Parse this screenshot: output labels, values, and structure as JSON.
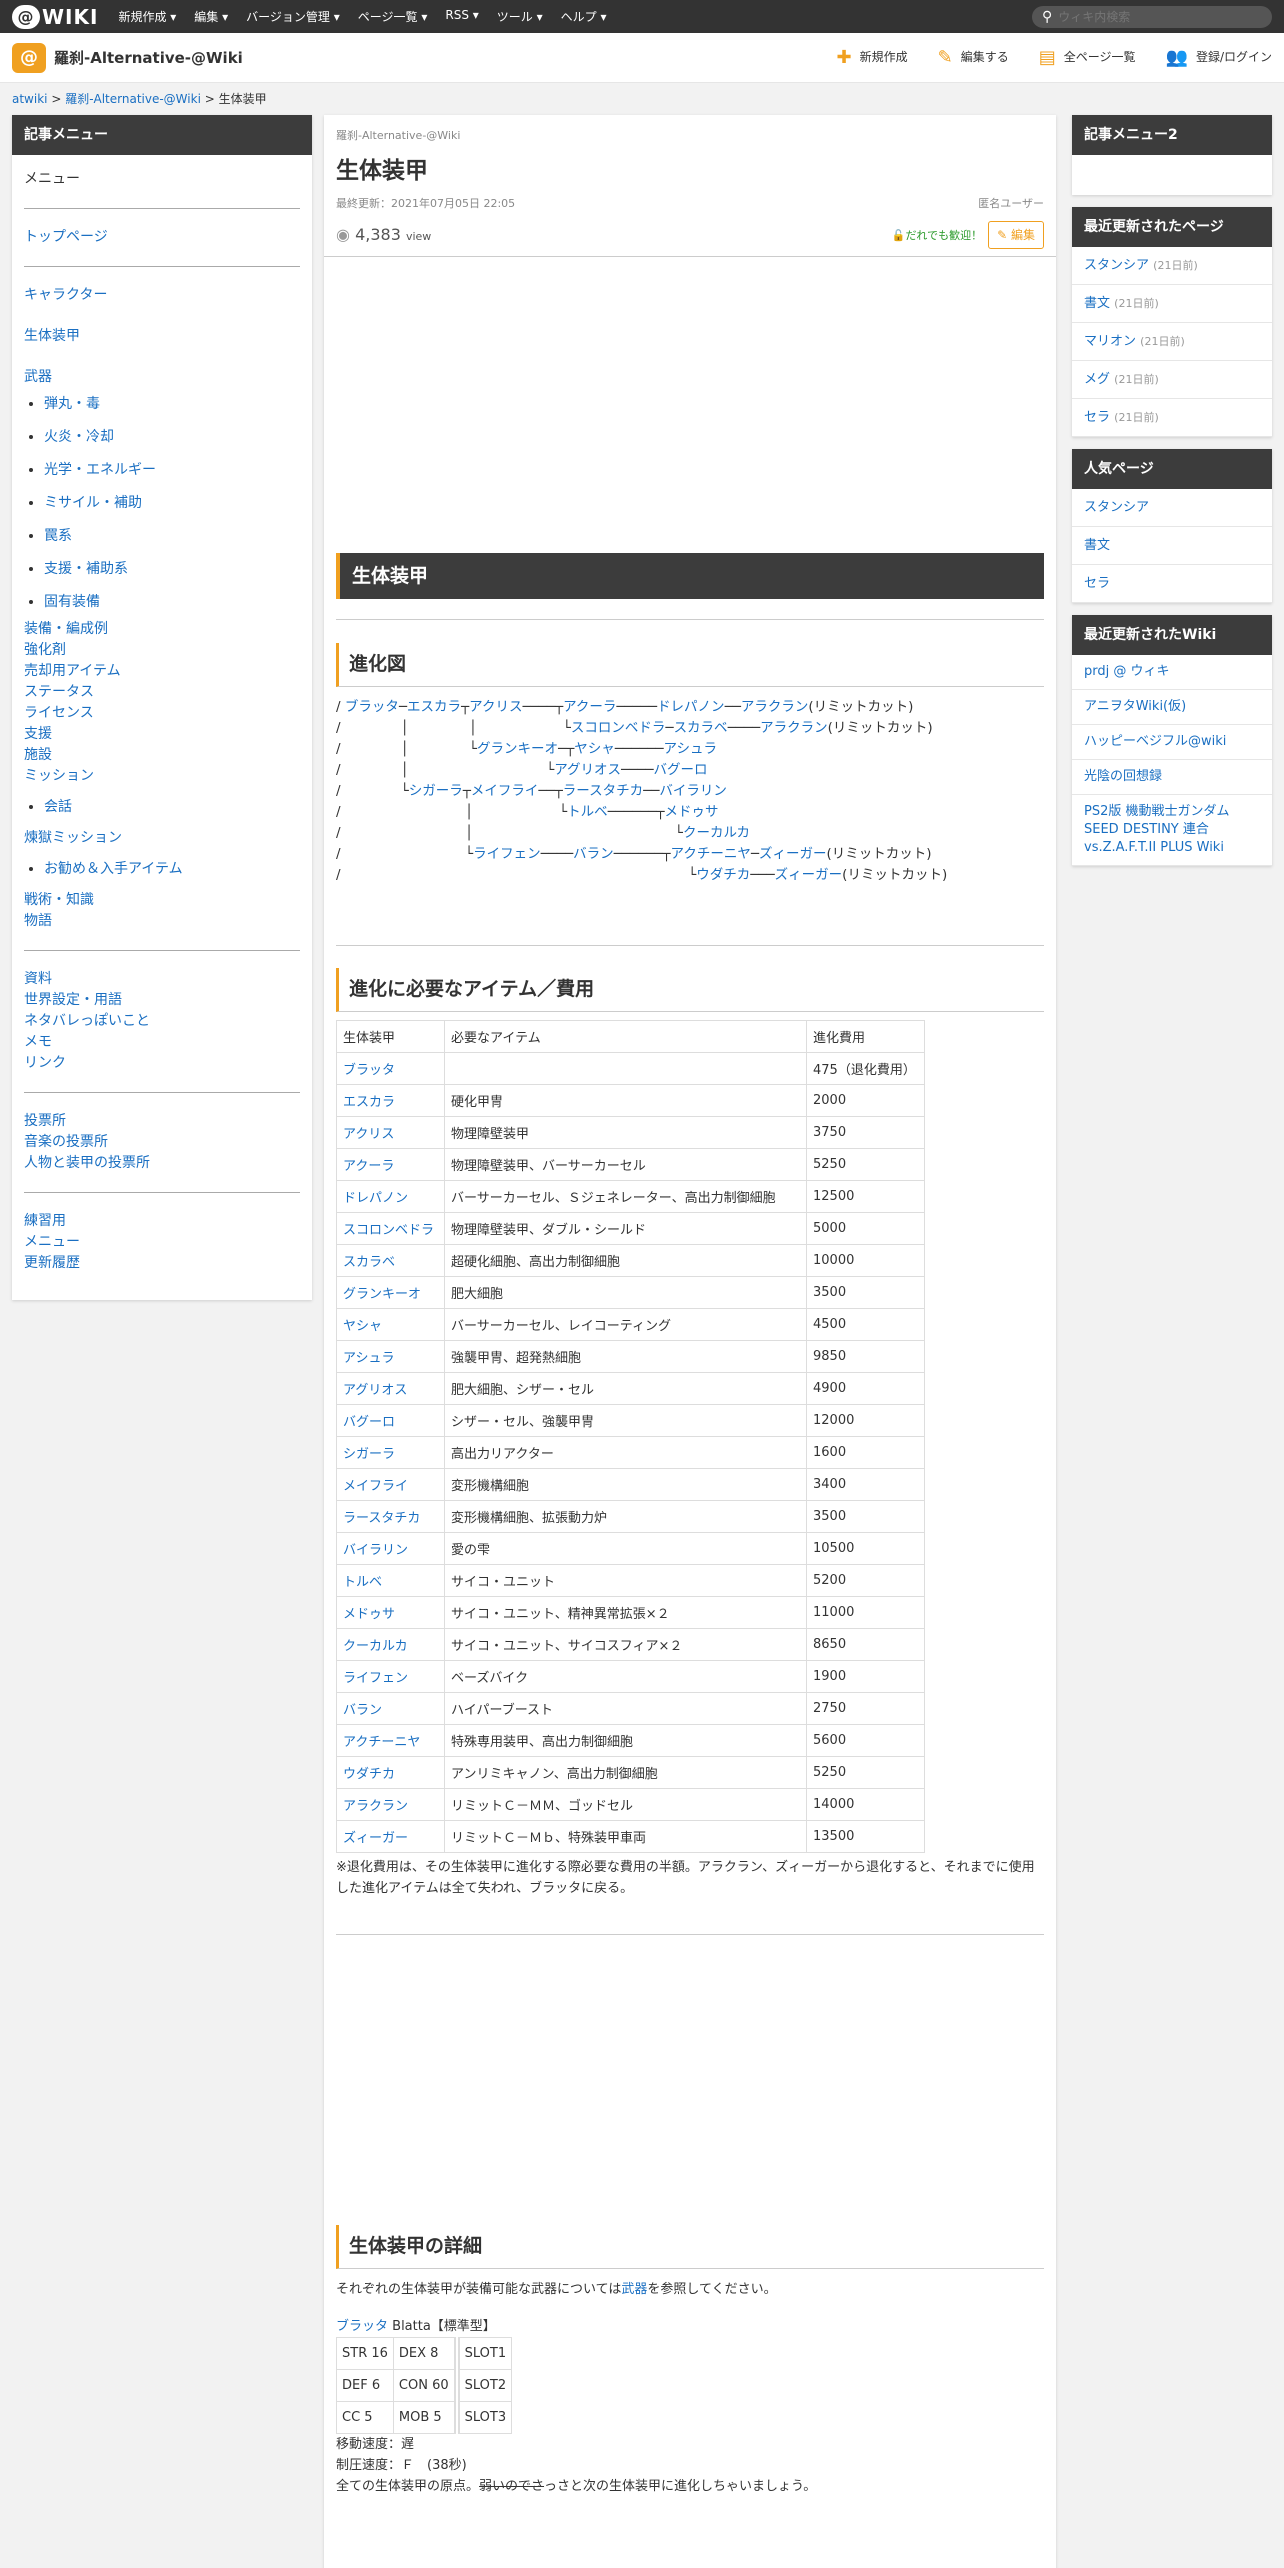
{
  "topbar": {
    "logo": "WIKI",
    "menu": [
      "新規作成 ▾",
      "編集 ▾",
      "バージョン管理 ▾",
      "ページ一覧 ▾",
      "RSS ▾",
      "ツール ▾",
      "ヘルプ ▾"
    ],
    "search_placeholder": "ウィキ内検索"
  },
  "site": {
    "title": "羅刹-Alternative-@Wiki",
    "actions": [
      {
        "icon": "plus-icon",
        "glyph": "✚",
        "label": "新規作成"
      },
      {
        "icon": "pencil-icon",
        "glyph": "✎",
        "label": "編集する"
      },
      {
        "icon": "page-icon",
        "glyph": "▤",
        "label": "全ページ一覧"
      },
      {
        "icon": "user-icon",
        "glyph": "👥",
        "label": "登録/ログイン"
      }
    ]
  },
  "breadcrumb": {
    "root": "atwiki",
    "site": "羅刹-Alternative-@Wiki",
    "page": "生体装甲",
    "sep": " > "
  },
  "left": {
    "title": "記事メニュー",
    "menu": "メニュー",
    "top": "トップページ",
    "chara": "キャラクター",
    "armor": "生体装甲",
    "weapon": "武器",
    "weapons": [
      "弾丸・毒",
      "火炎・冷却",
      "光学・エネルギー",
      "ミサイル・補助",
      "罠系",
      "支援・補助系",
      "固有装備"
    ],
    "misc": [
      "装備・編成例",
      "強化剤",
      "売却用アイテム",
      "ステータス",
      "ライセンス",
      "支援",
      "施設",
      "ミッション"
    ],
    "talk": "会話",
    "prison": "煉獄ミッション",
    "items": "お勧め＆入手アイテム",
    "battle": [
      "戦術・知識",
      "物語"
    ],
    "data": [
      "資料",
      "世界設定・用語",
      "ネタバレっぽいこと",
      "メモ",
      "リンク"
    ],
    "vote": [
      "投票所",
      "音楽の投票所",
      "人物と装甲の投票所"
    ],
    "practice": [
      "練習用",
      "メニュー",
      "更新履歴"
    ]
  },
  "main": {
    "wiki_name": "羅刹-Alternative-@Wiki",
    "title": "生体装甲",
    "updated": "最終更新：2021年07月05日 22:05",
    "user": "匿名ユーザー",
    "views": "4,383",
    "views_unit": "view",
    "welcome": "だれでも歓迎！",
    "edit": "編集",
    "h2": "生体装甲",
    "tree_h": "進化図",
    "cost_h": "進化に必要なアイテム／費用",
    "cost_head": [
      "生体装甲",
      "必要なアイテム",
      "進化費用"
    ],
    "cost_rows": [
      [
        "ブラッタ",
        "",
        "475（退化費用）"
      ],
      [
        "エスカラ",
        "硬化甲冑",
        "2000"
      ],
      [
        "アクリス",
        "物理障壁装甲",
        "3750"
      ],
      [
        "アクーラ",
        "物理障壁装甲、バーサーカーセル",
        "5250"
      ],
      [
        "ドレパノン",
        "バーサーカーセル、Ｓジェネレーター、高出力制御細胞",
        "12500"
      ],
      [
        "スコロンベドラ",
        "物理障壁装甲、ダブル・シールド",
        "5000"
      ],
      [
        "スカラベ",
        "超硬化細胞、高出力制御細胞",
        "10000"
      ],
      [
        "グランキーオ",
        "肥大細胞",
        "3500"
      ],
      [
        "ヤシャ",
        "バーサーカーセル、レイコーティング",
        "4500"
      ],
      [
        "アシュラ",
        "強襲甲冑、超発熱細胞",
        "9850"
      ],
      [
        "アグリオス",
        "肥大細胞、シザー・セル",
        "4900"
      ],
      [
        "バグーロ",
        "シザー・セル、強襲甲冑",
        "12000"
      ],
      [
        "シガーラ",
        "高出力リアクター",
        "1600"
      ],
      [
        "メイフライ",
        "変形機構細胞",
        "3400"
      ],
      [
        "ラースタチカ",
        "変形機構細胞、拡張動力炉",
        "3500"
      ],
      [
        "バイラリン",
        "愛の雫",
        "10500"
      ],
      [
        "トルベ",
        "サイコ・ユニット",
        "5200"
      ],
      [
        "メドゥサ",
        "サイコ・ユニット、精神異常拡張×２",
        "11000"
      ],
      [
        "クーカルカ",
        "サイコ・ユニット、サイコスフィア×２",
        "8650"
      ],
      [
        "ライフェン",
        "ベーズバイク",
        "1900"
      ],
      [
        "バラン",
        "ハイパーブースト",
        "2750"
      ],
      [
        "アクチーニヤ",
        "特殊専用装甲、高出力制御細胞",
        "5600"
      ],
      [
        "ウダチカ",
        "アンリミキャノン、高出力制御細胞",
        "5250"
      ],
      [
        "アラクラン",
        "リミットＣ－ＭＭ、ゴッドセル",
        "14000"
      ],
      [
        "ズィーガー",
        "リミットＣ－Ｍｂ、特殊装甲車両",
        "13500"
      ]
    ],
    "cost_note": "※退化費用は、その生体装甲に進化する際必要な費用の半額。アラクラン、ズィーガーから退化すると、それまでに使用した進化アイテムは全て失われ、ブラッタに戻る。",
    "detail_h": "生体装甲の詳細",
    "detail_intro_a": "それぞれの生体装甲が装備可能な武器については",
    "detail_intro_link": "武器",
    "detail_intro_b": "を参照してください。",
    "blatta_name": "ブラッタ",
    "blatta_sub": " Blatta【標準型】",
    "blatta_stats": [
      [
        "STR 16",
        "DEX 8",
        "SLOT1"
      ],
      [
        "DEF 6",
        "CON 60",
        "SLOT2"
      ],
      [
        "CC 5",
        "MOB 5",
        "SLOT3"
      ]
    ],
    "blatta_speed": "移動速度：遅",
    "blatta_limit": "制圧速度：Ｆ　(38秒)",
    "blatta_desc_a": "全ての生体装甲の原点。",
    "blatta_desc_strike": "弱いのでさ",
    "blatta_desc_b": "っさと次の生体装甲に進化しちゃいましょう。"
  },
  "right": {
    "menu2": "記事メニュー2",
    "recent_h": "最近更新されたページ",
    "recent": [
      [
        "スタンシア",
        "(21日前)"
      ],
      [
        "書文",
        "(21日前)"
      ],
      [
        "マリオン",
        "(21日前)"
      ],
      [
        "メグ",
        "(21日前)"
      ],
      [
        "セラ",
        "(21日前)"
      ]
    ],
    "popular_h": "人気ページ",
    "popular": [
      "スタンシア",
      "書文",
      "セラ"
    ],
    "wikis_h": "最近更新されたWiki",
    "wikis": [
      "prdj @ ウィキ",
      "アニヲタWiki(仮)",
      "ハッピーベジフル@wiki",
      "光陰の回想録",
      "PS2版 機動戦士ガンダムSEED DESTINY 連合vs.Z.A.F.T.II PLUS Wiki"
    ]
  }
}
